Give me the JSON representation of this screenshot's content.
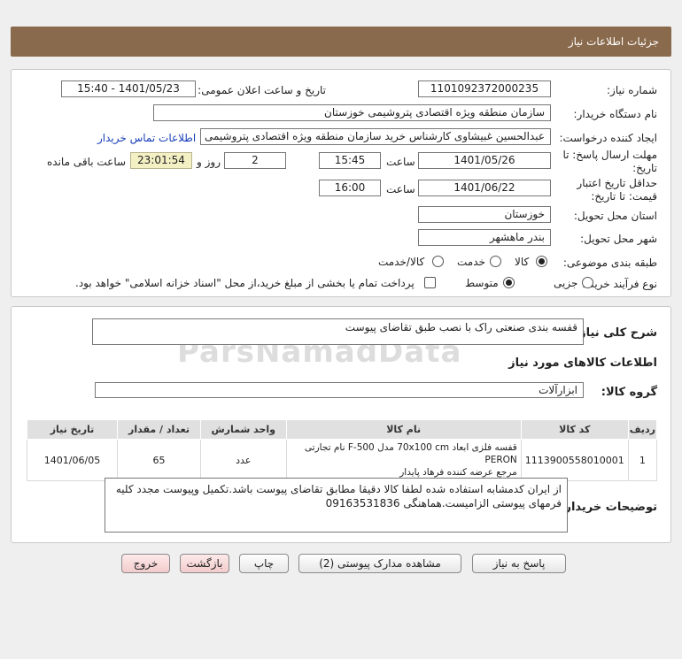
{
  "header": {
    "title": "جزئیات اطلاعات نیاز"
  },
  "form": {
    "need_number_label": "شماره نیاز:",
    "need_number": "1101092372000235",
    "announce_label": "تاریخ و ساعت اعلان عمومی:",
    "announce_value": "1401/05/23 - 15:40",
    "buyer_org_label": "نام دستگاه خریدار:",
    "buyer_org": "سازمان منطقه ویژه اقتصادی پتروشیمی خوزستان",
    "creator_label": "ایجاد کننده درخواست:",
    "creator": "عبدالحسین غبیشاوی کارشناس خرید سازمان منطقه ویژه اقتصادی پتروشیمی خوزستان",
    "contact_link": "اطلاعات تماس خریدار",
    "deadline_label_1": "مهلت ارسال پاسخ: تا",
    "deadline_label_2": "تاریخ:",
    "deadline_date": "1401/05/26",
    "time_label": "ساعت",
    "deadline_time": "15:45",
    "days_value": "2",
    "days_label": "روز و",
    "remaining_time": "23:01:54",
    "remaining_label": "ساعت باقی مانده",
    "validity_label_1": "حداقل تاریخ اعتبار",
    "validity_label_2": "قیمت: تا تاریخ:",
    "validity_date": "1401/06/22",
    "validity_time": "16:00",
    "province_label": "استان محل تحویل:",
    "province": "خوزستان",
    "city_label": "شهر محل تحویل:",
    "city": "بندر ماهشهر",
    "category_label": "طبقه بندی موضوعی:",
    "category_options": [
      "کالا",
      "خدمت",
      "کالا/خدمت"
    ],
    "category_selected": "کالا",
    "process_label": "نوع فرآیند خرید :",
    "process_options": [
      "جزیی",
      "متوسط"
    ],
    "process_selected": "متوسط",
    "payment_note": "پرداخت تمام یا بخشی از مبلغ خرید،از محل \"اسناد خزانه اسلامی\" خواهد بود."
  },
  "summary": {
    "title_label": "شرح کلی نیاز:",
    "title_value": "قفسه بندی صنعتی راک با نصب طبق تقاضای پیوست",
    "goods_info_heading": "اطلاعات کالاهای مورد نیاز",
    "group_label": "گروه کالا:",
    "group_value": "ابزارآلات"
  },
  "table": {
    "headers": [
      "ردیف",
      "کد کالا",
      "نام کالا",
      "واحد شمارش",
      "تعداد / مقدار",
      "تاریخ نیاز"
    ],
    "rows": [
      {
        "index": "1",
        "code": "1113900558010001",
        "name_line1": "قفسه فلزی ابعاد 70x100 cm مدل F-500 نام تجارتی PERON",
        "name_line2": "مرجع عرضه کننده فرهاد پایدار",
        "unit": "عدد",
        "qty": "65",
        "date": "1401/06/05"
      }
    ]
  },
  "buyer_notes": {
    "label": "توضیحات خریدار:",
    "text": "از ایران کدمشابه استفاده شده لطفا کالا دقیقا مطابق تقاضای پیوست باشد.تکمیل وپیوست مجدد کلیه فرمهای پیوستی الزامیست.هماهنگی 09163531836"
  },
  "buttons": {
    "reply": "پاسخ به نیاز",
    "attachments": "مشاهده مدارک پیوستی (2)",
    "print": "چاپ",
    "back": "بازگشت",
    "exit": "خروج"
  },
  "watermark": "ParsNamadData"
}
